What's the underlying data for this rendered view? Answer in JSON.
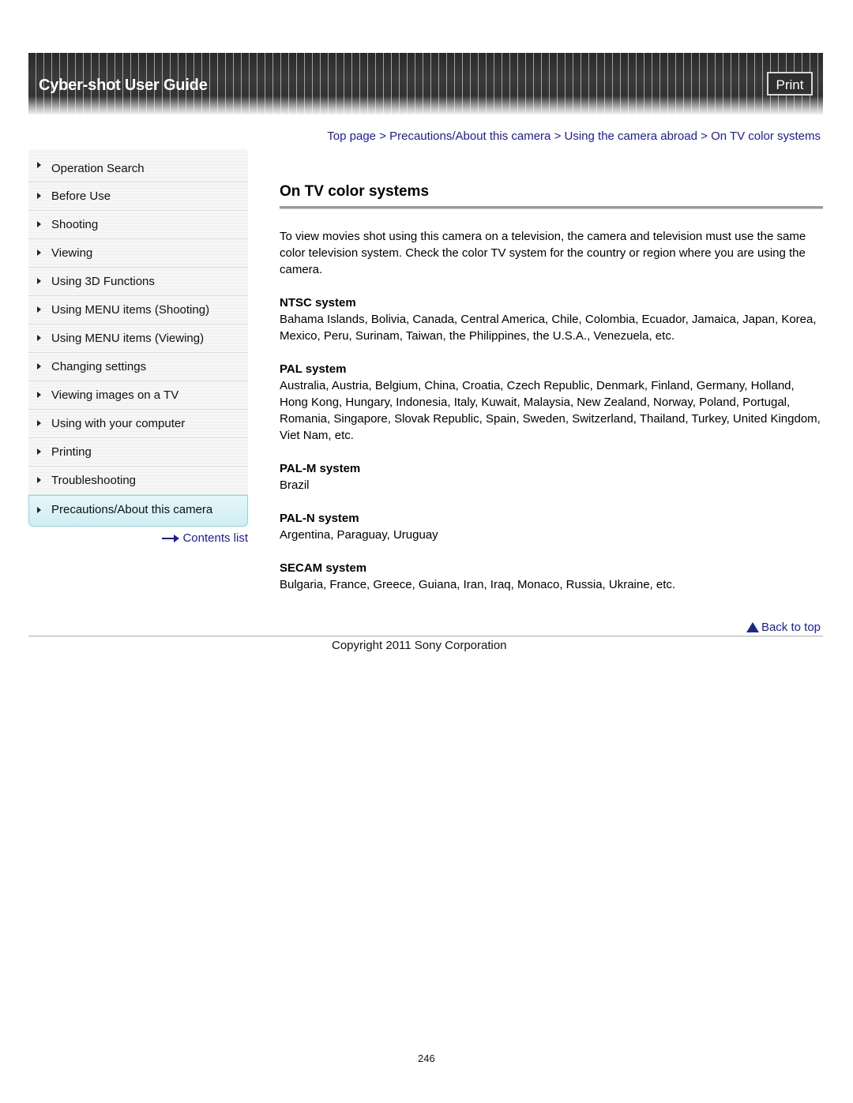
{
  "header": {
    "title": "Cyber-shot User Guide",
    "print_label": "Print"
  },
  "breadcrumb": [
    {
      "label": "Top page"
    },
    {
      "label": "Precautions/About this camera"
    },
    {
      "label": "Using the camera abroad"
    },
    {
      "label": "On TV color systems"
    }
  ],
  "breadcrumb_separator": ">",
  "sidebar": {
    "items": [
      {
        "label": "Operation Search"
      },
      {
        "label": "Before Use"
      },
      {
        "label": "Shooting"
      },
      {
        "label": "Viewing"
      },
      {
        "label": "Using 3D Functions"
      },
      {
        "label": "Using MENU items (Shooting)"
      },
      {
        "label": "Using MENU items (Viewing)"
      },
      {
        "label": "Changing settings"
      },
      {
        "label": "Viewing images on a TV"
      },
      {
        "label": "Using with your computer"
      },
      {
        "label": "Printing"
      },
      {
        "label": "Troubleshooting"
      },
      {
        "label": "Precautions/About this camera",
        "active": true
      }
    ],
    "contents_link": "Contents list"
  },
  "main": {
    "title": "On TV color systems",
    "intro": "To view movies shot using this camera on a television, the camera and television must use the same color television system. Check the color TV system for the country or region where you are using the camera.",
    "systems": [
      {
        "name": "NTSC system",
        "countries": "Bahama Islands, Bolivia, Canada, Central America, Chile, Colombia, Ecuador, Jamaica, Japan, Korea, Mexico, Peru, Surinam, Taiwan, the Philippines, the U.S.A., Venezuela, etc."
      },
      {
        "name": "PAL system",
        "countries": "Australia, Austria, Belgium, China, Croatia, Czech Republic, Denmark, Finland, Germany, Holland, Hong Kong, Hungary, Indonesia, Italy, Kuwait, Malaysia, New Zealand, Norway, Poland, Portugal, Romania, Singapore, Slovak Republic, Spain, Sweden, Switzerland, Thailand, Turkey, United Kingdom, Viet Nam, etc."
      },
      {
        "name": "PAL-M system",
        "countries": "Brazil"
      },
      {
        "name": "PAL-N system",
        "countries": "Argentina, Paraguay, Uruguay"
      },
      {
        "name": "SECAM system",
        "countries": "Bulgaria, France, Greece, Guiana, Iran, Iraq, Monaco, Russia, Ukraine, etc."
      }
    ]
  },
  "footer": {
    "back_to_top": "Back to top",
    "copyright": "Copyright 2011 Sony Corporation",
    "page_number": "246"
  },
  "colors": {
    "link": "#1a1aa6",
    "active_nav": "#cfeef4",
    "header_bg": "#333333"
  }
}
